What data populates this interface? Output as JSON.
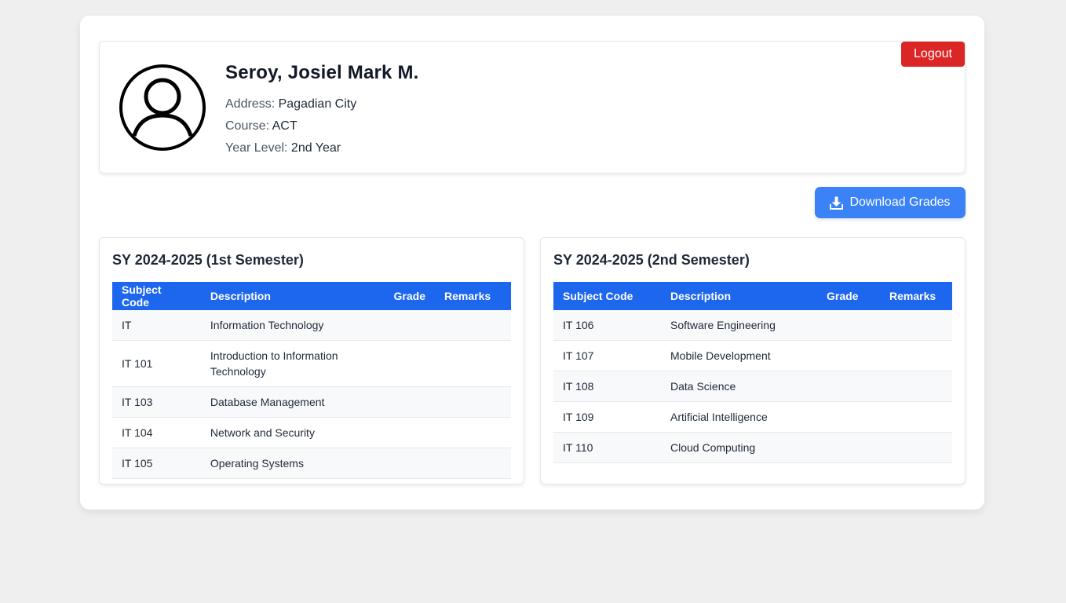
{
  "student": {
    "name": "Seroy, Josiel Mark M.",
    "address_label": "Address:",
    "address": "Pagadian City",
    "course_label": "Course:",
    "course": "ACT",
    "year_label": "Year Level:",
    "year": "2nd Year",
    "avatar_icon": "user-avatar-icon"
  },
  "header": {
    "logout_label": "Logout"
  },
  "actions": {
    "download_label": "Download Grades",
    "download_icon": "download-icon"
  },
  "colors": {
    "table_header": "#1d66ee",
    "download_button": "#3b82f6",
    "logout_button": "#dc2626"
  },
  "semesters": [
    {
      "title": "SY 2024-2025 (1st Semester)",
      "columns": [
        "Subject Code",
        "Description",
        "Grade",
        "Remarks"
      ],
      "rows": [
        {
          "code": "IT",
          "description": "Information Technology",
          "grade": "",
          "remarks": ""
        },
        {
          "code": "IT 101",
          "description": "Introduction to Information Technology",
          "grade": "",
          "remarks": ""
        },
        {
          "code": "IT 103",
          "description": "Database Management",
          "grade": "",
          "remarks": ""
        },
        {
          "code": "IT 104",
          "description": "Network and Security",
          "grade": "",
          "remarks": ""
        },
        {
          "code": "IT 105",
          "description": "Operating Systems",
          "grade": "",
          "remarks": ""
        }
      ]
    },
    {
      "title": "SY 2024-2025 (2nd Semester)",
      "columns": [
        "Subject Code",
        "Description",
        "Grade",
        "Remarks"
      ],
      "rows": [
        {
          "code": "IT 106",
          "description": "Software Engineering",
          "grade": "",
          "remarks": ""
        },
        {
          "code": "IT 107",
          "description": "Mobile Development",
          "grade": "",
          "remarks": ""
        },
        {
          "code": "IT 108",
          "description": "Data Science",
          "grade": "",
          "remarks": ""
        },
        {
          "code": "IT 109",
          "description": "Artificial Intelligence",
          "grade": "",
          "remarks": ""
        },
        {
          "code": "IT 110",
          "description": "Cloud Computing",
          "grade": "",
          "remarks": ""
        }
      ]
    }
  ]
}
